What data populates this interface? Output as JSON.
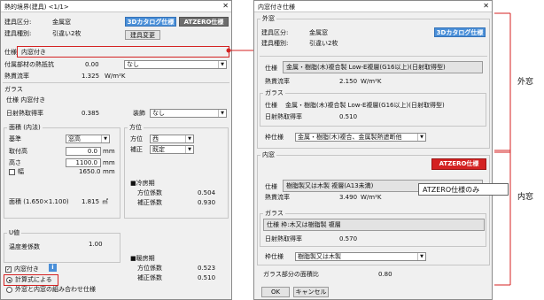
{
  "left_dialog": {
    "title": "熱的境界(建具) <1/1>",
    "close": "✕",
    "type_label": "建具区分:",
    "type_value": "金属窓",
    "kind_label": "建具種別:",
    "kind_value": "引違い2枚",
    "btn_catalog": "3Dカタログ仕様",
    "btn_atzero": "ATZERO仕様",
    "btn_change": "建具変更",
    "spec_label": "仕様",
    "spec_value": "内窓付き",
    "accessory_label": "付属部材の熱抵抗",
    "accessory_value": "0.00",
    "accessory_select": "なし",
    "heat_label": "熱貫流率",
    "heat_value": "1.325",
    "heat_unit": "W/m²K",
    "glass_group": "ガラス",
    "glass_spec": "仕様 内窓付き",
    "solar_label": "日射熱取得率",
    "solar_value": "0.385",
    "fitting_label": "装飾",
    "fitting_select": "なし",
    "area_group": "面積 (内法)",
    "base_label": "基準",
    "base_select": "窓高",
    "mount_label": "取付高",
    "mount_value": "0.0",
    "mount_unit": "mm",
    "height_label": "高さ",
    "height_value": "1100.0",
    "height_unit": "mm",
    "width_label": "幅",
    "width_value": "1650.0",
    "width_unit": "mm",
    "orient_group": "方位",
    "dir_label": "方位",
    "dir_select": "西",
    "corr_label": "補正",
    "corr_select": "既定",
    "cool_header": "■冷房期",
    "cool_dir_label": "方位係数",
    "cool_dir_value": "0.504",
    "cool_corr_label": "補正係数",
    "cool_corr_value": "0.930",
    "area_label": "面積 (1.650×1.100)",
    "area_value": "1.815",
    "area_unit": "㎡",
    "u_group": "U値",
    "temp_label": "温度差係数",
    "temp_value": "1.00",
    "heat_header": "■暖房期",
    "heat_dir_label": "方位係数",
    "heat_dir_value": "0.523",
    "heat_corr_label": "補正係数",
    "heat_corr_value": "0.510",
    "inner_check_label": "内窓付き",
    "info_icon": "i",
    "radio_calc": "計算式による",
    "radio_combo": "外窓と内窓の組み合わせ仕様"
  },
  "right_dialog": {
    "title": "内窓付き仕様",
    "close": "✕",
    "outer_group": "外窓",
    "type_label": "建具区分:",
    "type_value": "金属窓",
    "kind_label": "建具種別:",
    "kind_value": "引違い2枚",
    "btn_catalog": "3Dカタログ仕様",
    "outer_spec_label": "仕様",
    "outer_spec_value": "金属・樹脂(木)複合製 Low-E複層(G16以上)(日射取得型)",
    "outer_heat_label": "熱貫流率",
    "outer_heat_value": "2.150",
    "outer_heat_unit": "W/m²K",
    "outer_glass_group": "ガラス",
    "outer_glass_spec_label": "仕様",
    "outer_glass_spec_value": "金属・樹脂(木)複合製 Low-E複層(G16以上)(日射取得型)",
    "outer_solar_label": "日射熱取得率",
    "outer_solar_value": "0.510",
    "outer_frame_label": "枠仕様",
    "outer_frame_select": "金属・樹脂(木)複合、金属製熱遮断他",
    "inner_group": "内窓",
    "btn_atzero": "ATZERO仕様",
    "inner_spec_label": "仕様",
    "inner_spec_value": "樹脂製又は木製 複層(A13未満)",
    "inner_heat_label": "熱貫流率",
    "inner_heat_value": "3.490",
    "inner_heat_unit": "W/m²K",
    "inner_glass_group": "ガラス",
    "inner_glass_spec": "仕様 枠:木又は樹脂製 複層",
    "inner_solar_label": "日射熱取得率",
    "inner_solar_value": "0.570",
    "inner_frame_label": "枠仕様",
    "inner_frame_select": "樹脂製又は木製",
    "glass_ratio_label": "ガラス部分の面積比",
    "glass_ratio_value": "0.80",
    "ok": "OK",
    "cancel": "キャンセル"
  },
  "annotations": {
    "outer_label": "外窓",
    "inner_label": "内窓",
    "atzero_only": "ATZERO仕様のみ"
  },
  "colors": {
    "accent_blue": "#4a8fd8",
    "atzero_gray": "#6d6d6d",
    "highlight_red": "#d42222"
  }
}
